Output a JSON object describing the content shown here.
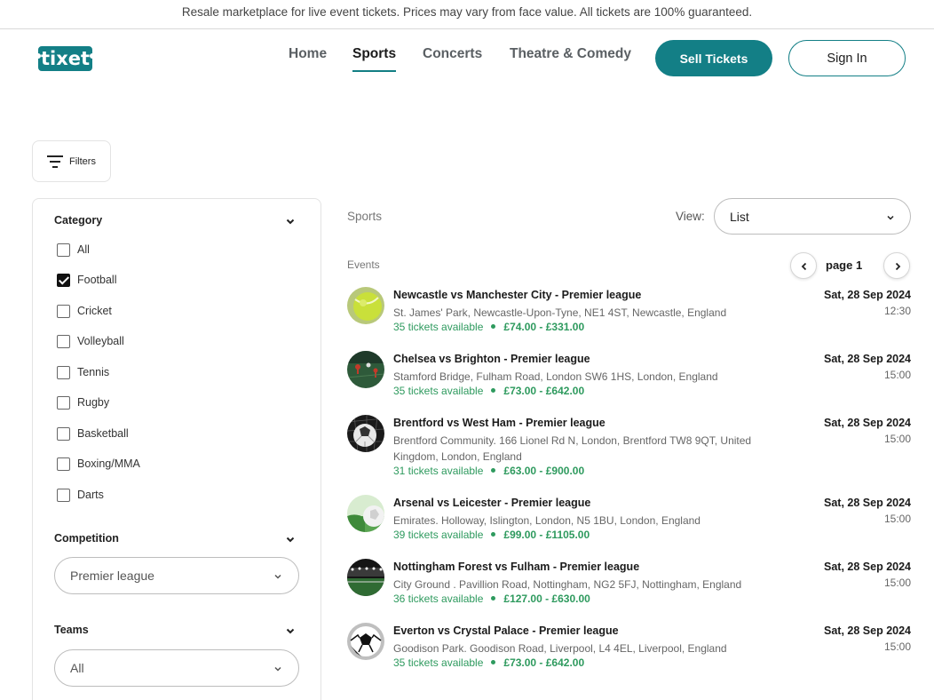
{
  "announcement": "Resale marketplace for live event tickets. Prices may vary from face value. All tickets are 100% guaranteed.",
  "brand": {
    "name": "tixet",
    "color": "#137f86"
  },
  "nav": [
    {
      "label": "Home",
      "active": false
    },
    {
      "label": "Sports",
      "active": true
    },
    {
      "label": "Concerts",
      "active": false
    },
    {
      "label": "Theatre & Comedy",
      "active": false
    }
  ],
  "header": {
    "sell_label": "Sell Tickets",
    "signin_label": "Sign In"
  },
  "filters_label": "Filters",
  "sidebar": {
    "category": {
      "title": "Category",
      "items": [
        {
          "label": "All",
          "checked": false
        },
        {
          "label": "Football",
          "checked": true
        },
        {
          "label": "Cricket",
          "checked": false
        },
        {
          "label": "Volleyball",
          "checked": false
        },
        {
          "label": "Tennis",
          "checked": false
        },
        {
          "label": "Rugby",
          "checked": false
        },
        {
          "label": "Basketball",
          "checked": false
        },
        {
          "label": "Boxing/MMA",
          "checked": false
        },
        {
          "label": "Darts",
          "checked": false
        }
      ]
    },
    "competition": {
      "title": "Competition",
      "selected": "Premier league"
    },
    "teams": {
      "title": "Teams",
      "selected": "All"
    }
  },
  "main": {
    "breadcrumb": "Sports",
    "view": {
      "label": "View:",
      "selected": "List"
    },
    "events_label": "Events",
    "pagination": {
      "label": "page 1"
    },
    "events": [
      {
        "title": "Newcastle vs Manchester City - Premier league",
        "venue": "St. James' Park, Newcastle-Upon-Tyne, NE1 4ST, Newcastle, England",
        "tickets": "35 tickets available",
        "price": "£74.00 - £331.00",
        "date": "Sat, 28 Sep 2024",
        "time": "12:30",
        "thumb": "tennis-ball"
      },
      {
        "title": "Chelsea vs Brighton - Premier league",
        "venue": "Stamford Bridge, Fulham Road, London SW6 1HS, London, England",
        "tickets": "35 tickets available",
        "price": "£73.00 - £642.00",
        "date": "Sat, 28 Sep 2024",
        "time": "15:00",
        "thumb": "pitch-players"
      },
      {
        "title": "Brentford vs West Ham - Premier league",
        "venue": "Brentford Community. 166 Lionel Rd N, London, Brentford TW8 9QT, United Kingdom, London, England",
        "tickets": "31 tickets available",
        "price": "£63.00 - £900.00",
        "date": "Sat, 28 Sep 2024",
        "time": "15:00",
        "thumb": "football-net"
      },
      {
        "title": "Arsenal vs Leicester - Premier league",
        "venue": "Emirates. Holloway, Islington, London, N5 1BU, London, England",
        "tickets": "39 tickets available",
        "price": "£99.00 - £1105.00",
        "date": "Sat, 28 Sep 2024",
        "time": "15:00",
        "thumb": "ball-on-grass"
      },
      {
        "title": "Nottingham Forest vs Fulham - Premier league",
        "venue": "City Ground . Pavillion Road, Nottingham, NG2 5FJ, Nottingham, England",
        "tickets": "36 tickets available",
        "price": "£127.00 - £630.00",
        "date": "Sat, 28 Sep 2024",
        "time": "15:00",
        "thumb": "stadium"
      },
      {
        "title": "Everton vs Crystal Palace - Premier league",
        "venue": "Goodison Park. Goodison Road, Liverpool, L4 4EL, Liverpool, England",
        "tickets": "35 tickets available",
        "price": "£73.00 - £642.00",
        "date": "Sat, 28 Sep 2024",
        "time": "15:00",
        "thumb": "football"
      }
    ]
  }
}
